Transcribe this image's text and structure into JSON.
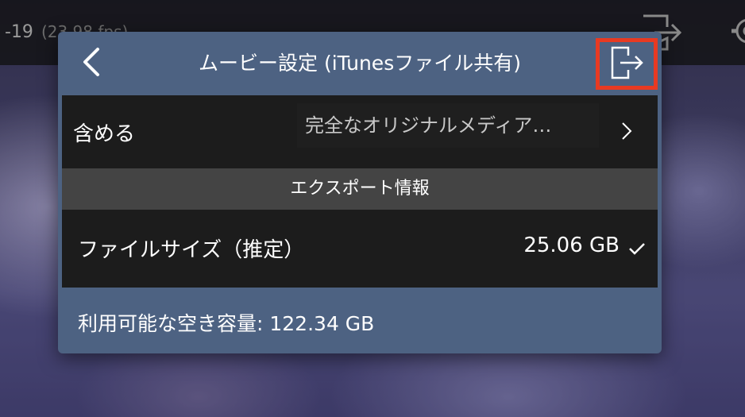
{
  "background": {
    "frame_rate_text": "-19",
    "fps_text": "(23.98 fps)",
    "export_icon": "export-icon",
    "gear_icon": "gear-icon"
  },
  "modal": {
    "title": "ムービー設定 (iTunesファイル共有)",
    "back_icon": "chevron-left-icon",
    "export_icon": "export-icon",
    "highlight_color": "#e83a22",
    "panel_color": "#4d6282",
    "include": {
      "label": "含める",
      "value": "完全なオリジナルメディア…",
      "chevron_icon": "chevron-right-icon"
    },
    "section_header": "エクスポート情報",
    "file_size": {
      "label": "ファイルサイズ（推定）",
      "value": "25.06 GB",
      "check_icon": "check-icon"
    },
    "available_space": "利用可能な空き容量: 122.34 GB"
  }
}
